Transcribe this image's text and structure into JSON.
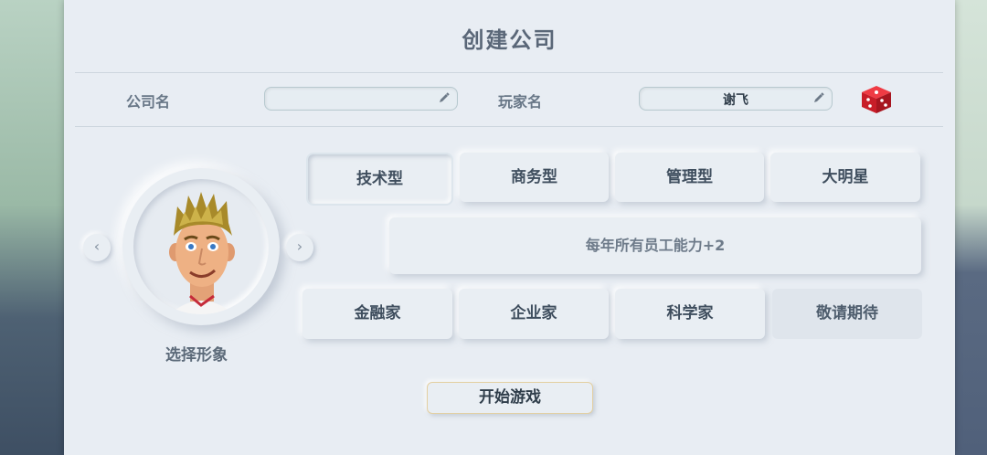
{
  "dialog": {
    "title": "创建公司"
  },
  "form": {
    "company_label": "公司名",
    "company_value": "",
    "player_label": "玩家名",
    "player_value": "谢飞"
  },
  "icons": {
    "company_edit": "pencil-icon",
    "player_edit": "pencil-icon",
    "randomize": "dice-icon",
    "prev": "chevron-left-icon",
    "next": "chevron-right-icon"
  },
  "avatar": {
    "prev_glyph": "‹",
    "next_glyph": "›",
    "choose_label": "选择形象"
  },
  "types": {
    "row1": [
      "技术型",
      "商务型",
      "管理型",
      "大明星"
    ],
    "selected": "技术型",
    "description": "每年所有员工能力+2",
    "row2": [
      "金融家",
      "企业家",
      "科学家",
      "敬请期待"
    ]
  },
  "actions": {
    "start_label": "开始游戏"
  },
  "colors": {
    "accent_border": "#e3cfa1",
    "dice_red": "#d9232e",
    "panel_bg": "#e8edf3"
  }
}
